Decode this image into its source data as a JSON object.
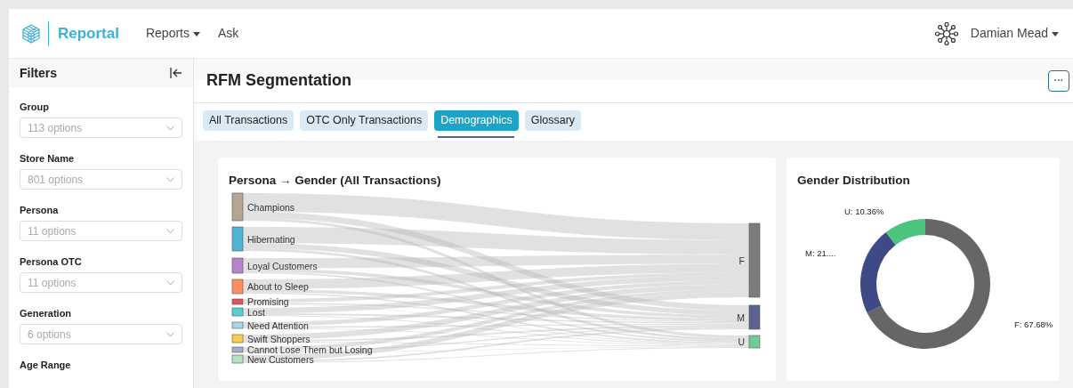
{
  "navbar": {
    "brand": "Reportal",
    "menu": [
      {
        "label": "Reports",
        "dropdown": true
      },
      {
        "label": "Ask",
        "dropdown": false
      }
    ],
    "user": "Damian Mead"
  },
  "sidebar": {
    "title": "Filters",
    "filters": [
      {
        "label": "Group",
        "placeholder": "113 options"
      },
      {
        "label": "Store Name",
        "placeholder": "801 options"
      },
      {
        "label": "Persona",
        "placeholder": "11 options"
      },
      {
        "label": "Persona OTC",
        "placeholder": "11 options"
      },
      {
        "label": "Generation",
        "placeholder": "6 options"
      },
      {
        "label": "Age Range"
      }
    ]
  },
  "page": {
    "title": "RFM Segmentation",
    "menu_button": "···",
    "tabs": [
      {
        "label": "All Transactions",
        "selected": false
      },
      {
        "label": "OTC Only Transactions",
        "selected": false
      },
      {
        "label": "Demographics",
        "selected": true
      },
      {
        "label": "Glossary",
        "selected": false
      }
    ]
  },
  "sankey": {
    "title": "Persona → Gender (All Transactions)",
    "sources": [
      {
        "label": "Champions",
        "color": "#b5a593"
      },
      {
        "label": "Hibernating",
        "color": "#4fb3d3"
      },
      {
        "label": "Loyal Customers",
        "color": "#b784cc"
      },
      {
        "label": "About to Sleep",
        "color": "#fc8f5f"
      },
      {
        "label": "Promising",
        "color": "#e0505f"
      },
      {
        "label": "Lost",
        "color": "#5acfcf"
      },
      {
        "label": "Need Attention",
        "color": "#a7d8ea"
      },
      {
        "label": "Swift Shoppers",
        "color": "#f8ce4e"
      },
      {
        "label": "Cannot Lose Them but Losing",
        "color": "#a8b0c8"
      },
      {
        "label": "New Customers",
        "color": "#b4e2c3"
      }
    ],
    "targets": [
      {
        "label": "F",
        "color": "#7c7c7c"
      },
      {
        "label": "M",
        "color": "#5c6392"
      },
      {
        "label": "U",
        "color": "#72cc95"
      }
    ]
  },
  "gender_distribution": {
    "title": "Gender Distribution",
    "chart_data": {
      "type": "donut",
      "values": [
        67.68,
        21.96,
        10.36
      ],
      "colors": [
        "#666666",
        "#3d4a85",
        "#4cc47e"
      ],
      "value_labels": [
        "F: 67.68%",
        "M: 21....",
        "U: 10.36%"
      ]
    }
  }
}
